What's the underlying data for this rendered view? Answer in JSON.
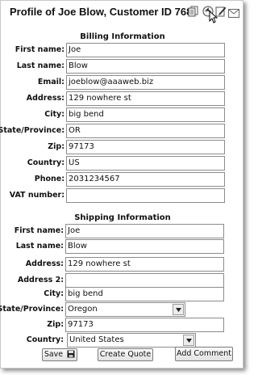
{
  "header": {
    "title": "Profile of Joe Blow, Customer ID 768",
    "icons": [
      "copy-icon",
      "undo-icon",
      "edit-icon",
      "mail-icon"
    ]
  },
  "billing": {
    "title": "Billing Information",
    "first_name": {
      "label": "First name:",
      "value": "Joe"
    },
    "last_name": {
      "label": "Last name:",
      "value": "Blow"
    },
    "email": {
      "label": "Email:",
      "value": "joeblow@aaaweb.biz"
    },
    "address": {
      "label": "Address:",
      "value": "129 nowhere st"
    },
    "city": {
      "label": "City:",
      "value": "big bend"
    },
    "state": {
      "label": "State/Province:",
      "value": "OR"
    },
    "zip": {
      "label": "Zip:",
      "value": "97173"
    },
    "country": {
      "label": "Country:",
      "value": "US"
    },
    "phone": {
      "label": "Phone:",
      "value": "2031234567"
    },
    "vat": {
      "label": "VAT number:",
      "value": ""
    }
  },
  "shipping": {
    "title": "Shipping Information",
    "first_name": {
      "label": "First name:",
      "value": "Joe"
    },
    "last_name": {
      "label": "Last name:",
      "value": "Blow"
    },
    "address": {
      "label": "Address:",
      "value": "129 nowhere st"
    },
    "address2": {
      "label": "Address 2:",
      "value": ""
    },
    "city": {
      "label": "City:",
      "value": "big bend"
    },
    "state": {
      "label": "State/Province:",
      "value": "Oregon"
    },
    "zip": {
      "label": "Zip:",
      "value": "97173"
    },
    "country": {
      "label": "Country:",
      "value": "United States"
    }
  },
  "buttons": {
    "save": "Save",
    "create_quote": "Create Quote",
    "add_comment": "Add Comment"
  },
  "colors": {
    "input_border": "#8c8c8c",
    "button_border": "#7a7a7a"
  }
}
